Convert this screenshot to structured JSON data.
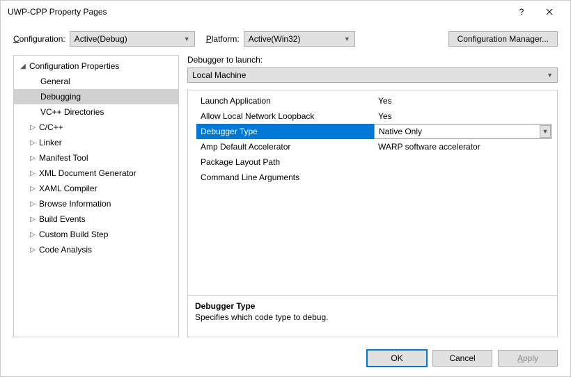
{
  "window": {
    "title": "UWP-CPP Property Pages"
  },
  "config_row": {
    "config_label": "Configuration:",
    "config_value": "Active(Debug)",
    "platform_label": "Platform:",
    "platform_value": "Active(Win32)",
    "manager_button": "Configuration Manager..."
  },
  "tree": {
    "root": "Configuration Properties",
    "children": [
      "General",
      "Debugging",
      "VC++ Directories"
    ],
    "nodes": [
      "C/C++",
      "Linker",
      "Manifest Tool",
      "XML Document Generator",
      "XAML Compiler",
      "Browse Information",
      "Build Events",
      "Custom Build Step",
      "Code Analysis"
    ]
  },
  "right": {
    "launch_label": "Debugger to launch:",
    "launcher": "Local Machine",
    "grid": [
      {
        "prop": "Launch Application",
        "val": "Yes"
      },
      {
        "prop": "Allow Local Network Loopback",
        "val": "Yes"
      },
      {
        "prop": "Debugger Type",
        "val": "Native Only"
      },
      {
        "prop": "Amp Default Accelerator",
        "val": "WARP software accelerator"
      },
      {
        "prop": "Package Layout Path",
        "val": ""
      },
      {
        "prop": "Command Line Arguments",
        "val": ""
      }
    ],
    "desc_title": "Debugger Type",
    "desc_text": "Specifies which code type to debug."
  },
  "buttons": {
    "ok": "OK",
    "cancel": "Cancel",
    "apply": "Apply"
  }
}
